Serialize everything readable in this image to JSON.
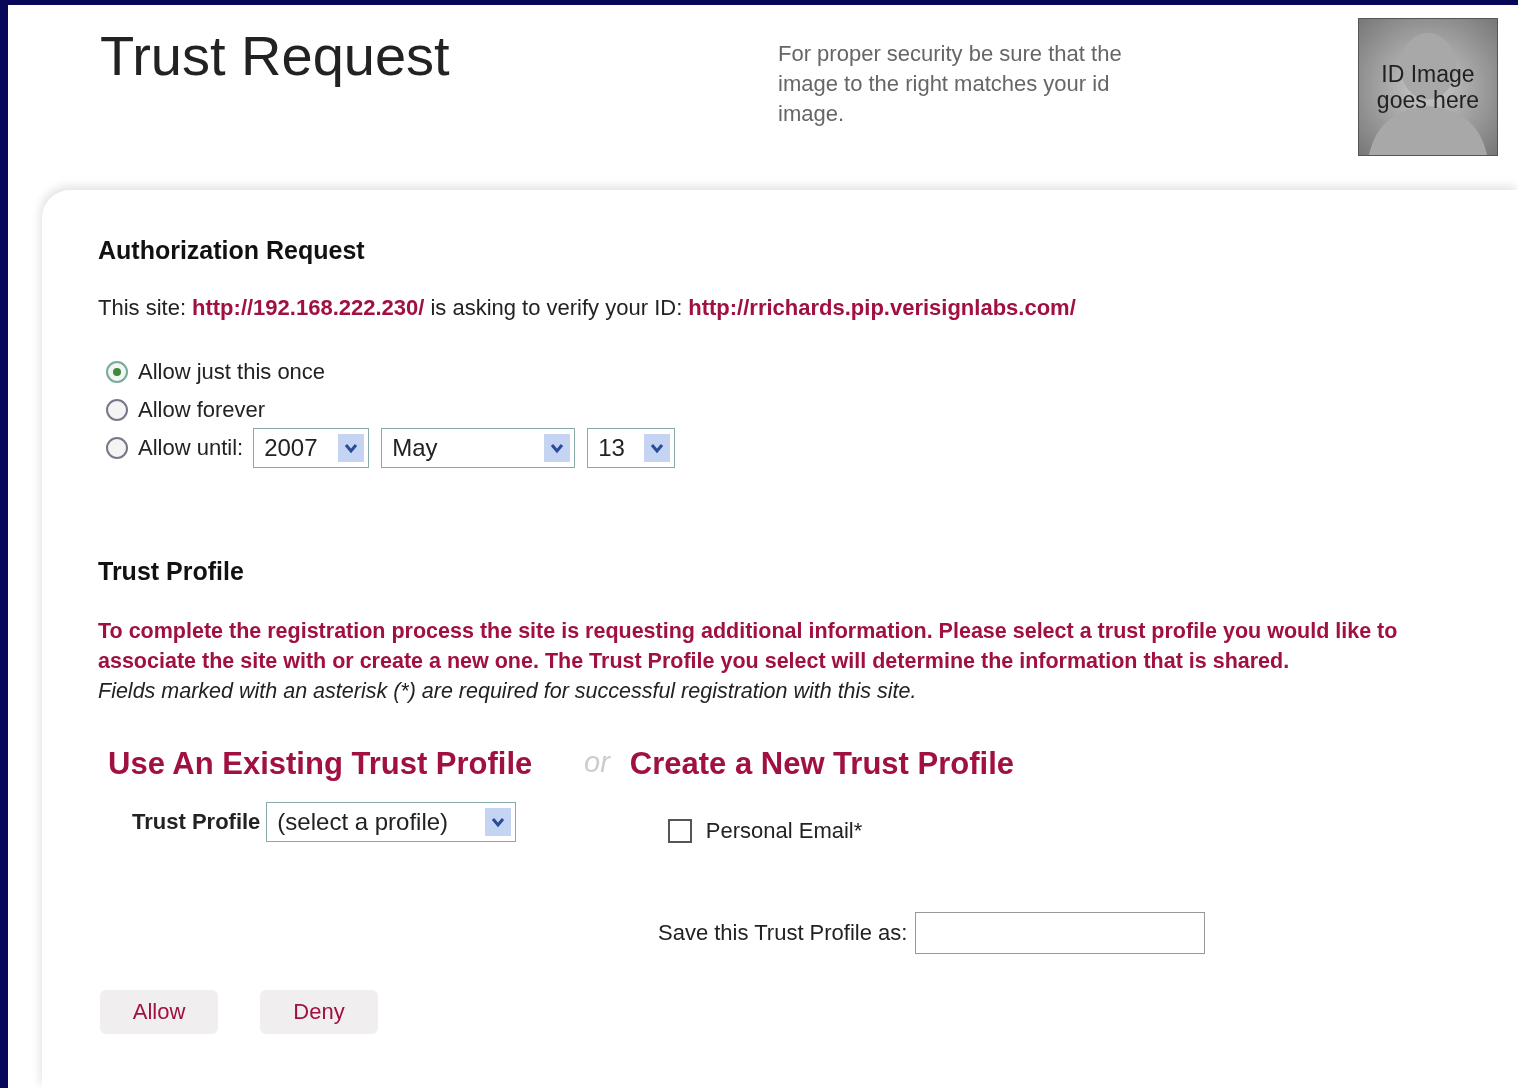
{
  "header": {
    "title": "Trust Request",
    "security_note": "For proper security be sure that the image to the right matches your id image.",
    "id_image_text": "ID Image goes here"
  },
  "authorization": {
    "heading": "Authorization Request",
    "site_prefix": "This site:",
    "site_url": "http://192.168.222.230/",
    "middle": "is asking to verify your ID:",
    "id_url": "http://rrichards.pip.verisignlabs.com/",
    "options": [
      {
        "label": "Allow just this once",
        "selected": true
      },
      {
        "label": "Allow forever",
        "selected": false
      },
      {
        "label": "Allow until:",
        "selected": false
      }
    ],
    "until": {
      "year": "2007",
      "month": "May",
      "day": "13"
    }
  },
  "trust_profile": {
    "heading": "Trust Profile",
    "notice": "To complete the registration process the site is requesting additional information. Please select a trust profile you would like to associate the site with or create a new one. The Trust Profile you select will determine the information that is shared.",
    "required_note": "Fields marked with an asterisk (*) are required for successful registration with this site.",
    "existing_heading": "Use An Existing Trust Profile",
    "or": "or",
    "new_heading": "Create a New Trust Profile",
    "profile_label": "Trust Profile",
    "profile_select": "(select a profile)",
    "fields": [
      {
        "label": "Personal Email*",
        "checked": false
      }
    ],
    "save_label": "Save this Trust Profile as:"
  },
  "buttons": [
    "Allow",
    "Deny"
  ]
}
